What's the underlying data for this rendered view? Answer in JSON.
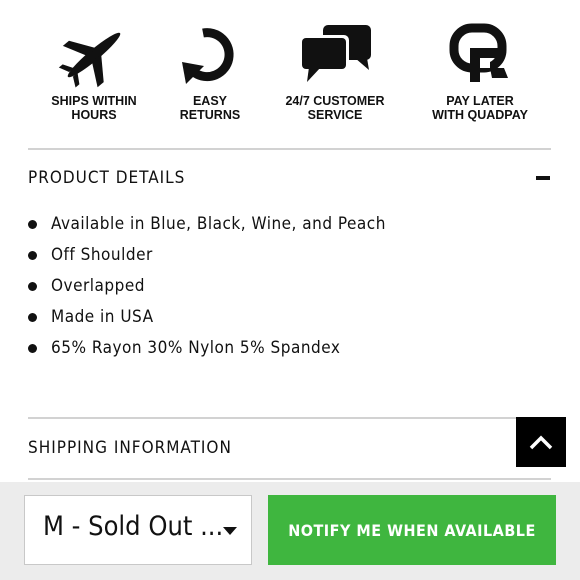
{
  "features": [
    {
      "icon": "airplane-icon",
      "line1": "SHIPS WITHIN",
      "line2": "HOURS"
    },
    {
      "icon": "return-arrow-icon",
      "line1": "EASY",
      "line2": "RETURNS"
    },
    {
      "icon": "chat-bubbles-icon",
      "line1": "24/7 CUSTOMER",
      "line2": "SERVICE"
    },
    {
      "icon": "quadpay-logo-icon",
      "line1": "PAY LATER",
      "line2": "WITH QUADPAY"
    }
  ],
  "product_details": {
    "title": "PRODUCT DETAILS",
    "toggle_icon": "minus-icon",
    "items": [
      "Available in Blue, Black, Wine, and Peach",
      "Off Shoulder",
      "Overlapped",
      "Made in USA",
      "65% Rayon 30% Nylon 5% Spandex"
    ]
  },
  "shipping": {
    "title": "SHIPPING INFORMATION"
  },
  "back_to_top_icon": "chevron-up-icon",
  "purchase_bar": {
    "size_select_value": "M - Sold Out ...",
    "notify_label": "NOTIFY ME WHEN AVAILABLE"
  },
  "colors": {
    "accent_green": "#3fb63f",
    "bar_bg": "#ececec",
    "divider": "#d2d2d2"
  }
}
